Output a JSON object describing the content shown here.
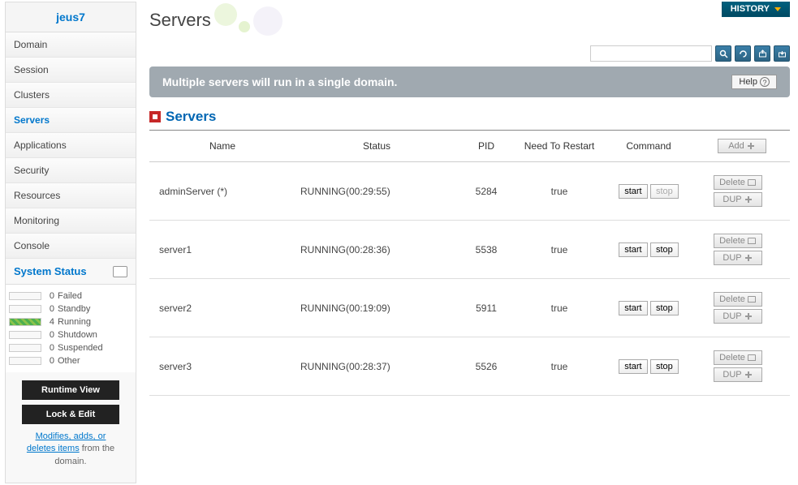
{
  "sidebar": {
    "header": "jeus7",
    "items": [
      {
        "label": "Domain",
        "active": false
      },
      {
        "label": "Session",
        "active": false
      },
      {
        "label": "Clusters",
        "active": false
      },
      {
        "label": "Servers",
        "active": true
      },
      {
        "label": "Applications",
        "active": false
      },
      {
        "label": "Security",
        "active": false
      },
      {
        "label": "Resources",
        "active": false
      },
      {
        "label": "Monitoring",
        "active": false
      },
      {
        "label": "Console",
        "active": false
      }
    ],
    "system_status_title": "System Status",
    "statuses": [
      {
        "count": "0",
        "label": "Failed",
        "running": false
      },
      {
        "count": "0",
        "label": "Standby",
        "running": false
      },
      {
        "count": "4",
        "label": "Running",
        "running": true
      },
      {
        "count": "0",
        "label": "Shutdown",
        "running": false
      },
      {
        "count": "0",
        "label": "Suspended",
        "running": false
      },
      {
        "count": "0",
        "label": "Other",
        "running": false
      }
    ],
    "runtime_btn": "Runtime View",
    "lock_btn": "Lock & Edit",
    "help_link": "Modifies, adds, or deletes items",
    "help_rest": " from the domain."
  },
  "header": {
    "history": "HISTORY",
    "search_placeholder": ""
  },
  "page": {
    "title": "Servers",
    "banner": "Multiple servers will run in a single domain.",
    "help": "Help",
    "section_title": "Servers"
  },
  "table": {
    "columns": {
      "name": "Name",
      "status": "Status",
      "pid": "PID",
      "restart": "Need To Restart",
      "command": "Command"
    },
    "add": "Add",
    "delete": "Delete",
    "dup": "DUP",
    "start": "start",
    "stop": "stop",
    "rows": [
      {
        "name": "adminServer (*)",
        "status": "RUNNING(00:29:55)",
        "pid": "5284",
        "restart": "true",
        "stop_disabled": true
      },
      {
        "name": "server1",
        "status": "RUNNING(00:28:36)",
        "pid": "5538",
        "restart": "true",
        "stop_disabled": false
      },
      {
        "name": "server2",
        "status": "RUNNING(00:19:09)",
        "pid": "5911",
        "restart": "true",
        "stop_disabled": false
      },
      {
        "name": "server3",
        "status": "RUNNING(00:28:37)",
        "pid": "5526",
        "restart": "true",
        "stop_disabled": false
      }
    ]
  }
}
